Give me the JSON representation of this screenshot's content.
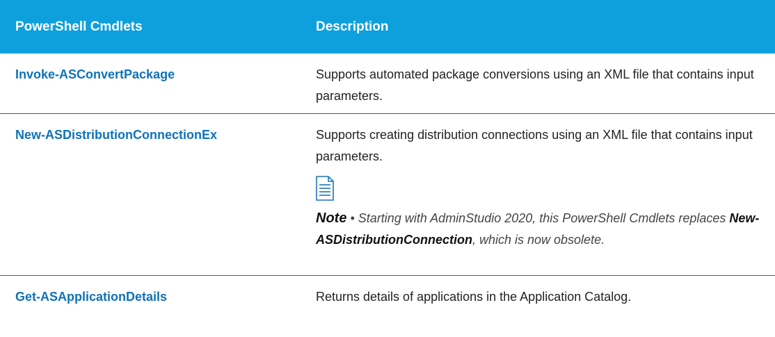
{
  "header": {
    "col1": "PowerShell Cmdlets",
    "col2": "Description"
  },
  "rows": [
    {
      "cmdlet": "Invoke-ASConvertPackage",
      "description": "Supports automated package conversions using an XML file that contains input parameters."
    },
    {
      "cmdlet": "New-ASDistributionConnectionEx",
      "description": "Supports creating distribution connections using an XML file that contains input parameters.",
      "note": {
        "icon": "note-document-icon",
        "label": "Note",
        "bullet": "•",
        "text_before": "Starting with AdminStudio 2020, this PowerShell Cmdlets replaces",
        "ref": "New-ASDistributionConnection",
        "text_after": ", which is now obsolete."
      }
    },
    {
      "cmdlet": "Get-ASApplicationDetails",
      "description": "Returns details of applications in the Application Catalog."
    }
  ],
  "colors": {
    "header_bg": "#0ea0dd",
    "link": "#0f72b8"
  }
}
